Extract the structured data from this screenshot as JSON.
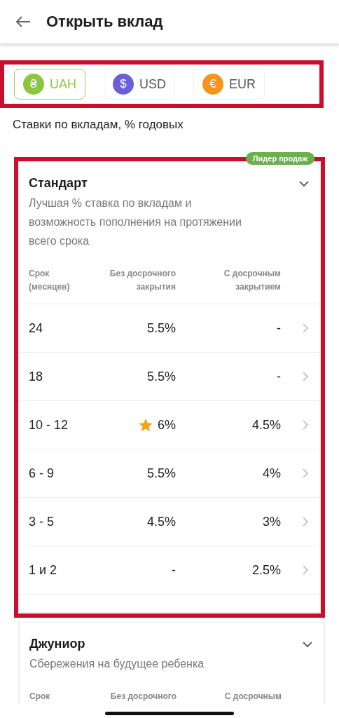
{
  "header": {
    "title": "Открыть вклад"
  },
  "currencies": {
    "highlighted": true,
    "items": [
      {
        "code": "UAH",
        "symbol": "₴",
        "color": "#8cc63f",
        "selected": true
      },
      {
        "code": "USD",
        "symbol": "$",
        "color": "#6a5fd6",
        "selected": false
      },
      {
        "code": "EUR",
        "symbol": "€",
        "color": "#f7941d",
        "selected": false
      }
    ]
  },
  "caption": "Ставки по вкладам, % годовых",
  "plans": [
    {
      "title": "Стандарт",
      "badge": "Лидер продаж",
      "highlighted": true,
      "description": "Лучшая % ставка по вкладам и возможность пополнения на протяжении всего срока",
      "columns": [
        "Срок\n(месяцев)",
        "Без досрочного\nзакрытия",
        "С досрочным\nзакрытием"
      ],
      "rows": [
        {
          "term": "24",
          "no_early": "5.5%",
          "early": "-",
          "best": false
        },
        {
          "term": "18",
          "no_early": "5.5%",
          "early": "-",
          "best": false
        },
        {
          "term": "10 - 12",
          "no_early": "6%",
          "early": "4.5%",
          "best": true
        },
        {
          "term": "6 - 9",
          "no_early": "5.5%",
          "early": "4%",
          "best": false
        },
        {
          "term": "3 - 5",
          "no_early": "4.5%",
          "early": "3%",
          "best": false
        },
        {
          "term": "1 и 2",
          "no_early": "-",
          "early": "2.5%",
          "best": false
        }
      ]
    },
    {
      "title": "Джуниор",
      "highlighted": false,
      "description": "Сбережения на будущее ребенка",
      "columns": [
        "Срок",
        "Без досрочного",
        "С досрочным"
      ]
    }
  ]
}
